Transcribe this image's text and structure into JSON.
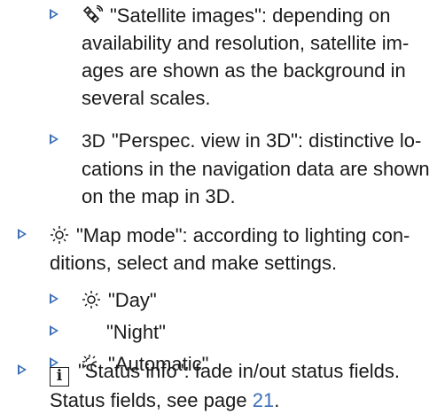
{
  "items": [
    {
      "icon": "satellite-icon",
      "lines": [
        "\"Satellite images\": depending on",
        "availability and resolution, satellite im-",
        "ages are shown as the background in",
        "several scales."
      ]
    },
    {
      "icon_text": "3D",
      "lines": [
        "\"Perspec. view in 3D\": distinctive lo-",
        "cations in the navigation data are shown",
        "on the map in 3D."
      ]
    },
    {
      "icon": "sun-icon",
      "lines": [
        "\"Map mode\": according to lighting con-",
        "ditions, select and make settings."
      ]
    },
    {
      "icon": "sun-icon",
      "lines": [
        "\"Day\""
      ]
    },
    {
      "icon": "moon-icon",
      "lines": [
        "\"Night\""
      ]
    },
    {
      "icon": "sun-moon-icon",
      "lines": [
        "\"Automatic\""
      ]
    },
    {
      "icon_text": "i",
      "icon": "info-icon",
      "lines": [
        "\"Status info\": fade in/out status fields."
      ],
      "tail_text": "Status fields, see page ",
      "link_text": "21",
      "tail_end": "."
    }
  ],
  "colors": {
    "marker": "#3b6fb6",
    "link": "#3b6fb6",
    "text": "#1a1a1a"
  }
}
